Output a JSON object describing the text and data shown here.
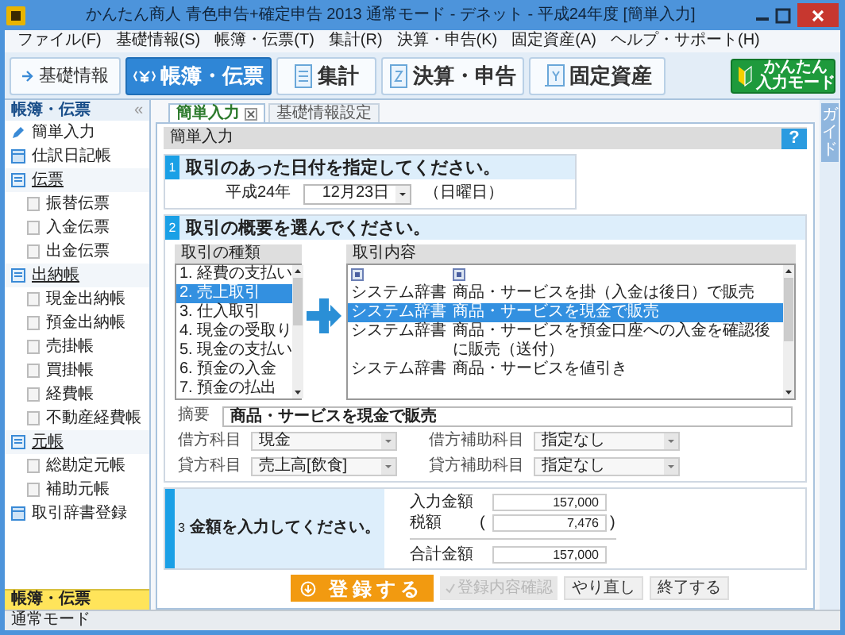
{
  "window": {
    "title": "かんたん商人 青色申告+確定申告 2013 通常モード - デネット - 平成24年度 [簡単入力]"
  },
  "menu": [
    "ファイル(F)",
    "基礎情報(S)",
    "帳簿・伝票(T)",
    "集計(R)",
    "決算・申告(K)",
    "固定資産(A)",
    "ヘルプ・サポート(H)"
  ],
  "toolbar": [
    {
      "label": "基礎情報",
      "kind": "arrow",
      "selected": false
    },
    {
      "label": "帳簿・伝票",
      "kind": "yen",
      "selected": true
    },
    {
      "label": "集計",
      "kind": "sheet",
      "selected": false
    },
    {
      "label": "決算・申告",
      "kind": "doc",
      "selected": false
    },
    {
      "label": "固定資産",
      "kind": "asset",
      "selected": false
    }
  ],
  "easy_mode_button": {
    "line1": "かんたん",
    "line2": "入力モード"
  },
  "sidebar": {
    "title": "帳簿・伝票",
    "collapse": "«",
    "items": [
      {
        "label": "簡単入力",
        "kind": "tool"
      },
      {
        "label": "仕訳日記帳",
        "kind": "book"
      },
      {
        "label": "伝票",
        "kind": "group",
        "children": [
          {
            "label": "振替伝票",
            "kind": "page"
          },
          {
            "label": "入金伝票",
            "kind": "page"
          },
          {
            "label": "出金伝票",
            "kind": "page"
          }
        ]
      },
      {
        "label": "出納帳",
        "kind": "group",
        "children": [
          {
            "label": "現金出納帳",
            "kind": "page"
          },
          {
            "label": "預金出納帳",
            "kind": "page"
          },
          {
            "label": "売掛帳",
            "kind": "page"
          },
          {
            "label": "買掛帳",
            "kind": "page"
          },
          {
            "label": "経費帳",
            "kind": "page"
          },
          {
            "label": "不動産経費帳",
            "kind": "page"
          }
        ]
      },
      {
        "label": "元帳",
        "kind": "group",
        "children": [
          {
            "label": "総勘定元帳",
            "kind": "page"
          },
          {
            "label": "補助元帳",
            "kind": "page"
          }
        ]
      },
      {
        "label": "取引辞書登録",
        "kind": "book"
      }
    ],
    "footer": "帳簿・伝票"
  },
  "tabs": [
    {
      "label": "簡単入力",
      "selected": true,
      "closable": true
    },
    {
      "label": "基礎情報設定",
      "selected": false,
      "closable": false
    }
  ],
  "panel": {
    "title": "簡単入力",
    "help": "?"
  },
  "guide_tab": "ガイド",
  "step1": {
    "number": "1",
    "title": "取引のあった日付を指定してください。",
    "era_year": "平成24年",
    "date": "12月23日",
    "weekday": "（日曜日）"
  },
  "step2": {
    "number": "2",
    "title": "取引の概要を選んでください。",
    "kinds_title": "取引の種類",
    "kinds": [
      {
        "label": "1. 経費の支払い",
        "selected": false
      },
      {
        "label": "2. 売上取引",
        "selected": true
      },
      {
        "label": "3. 仕入取引",
        "selected": false
      },
      {
        "label": "4. 現金の受取り",
        "selected": false
      },
      {
        "label": "5. 現金の支払い",
        "selected": false
      },
      {
        "label": "6. 預金の入金",
        "selected": false
      },
      {
        "label": "7. 預金の払出",
        "selected": false
      }
    ],
    "contents_title": "取引内容",
    "contents": [
      {
        "source": "システム辞書",
        "description": "商品・サービスを掛（入金は後日）で販売",
        "selected": false
      },
      {
        "source": "システム辞書",
        "description": "商品・サービスを現金で販売",
        "selected": true
      },
      {
        "source": "システム辞書",
        "description": "商品・サービスを預金口座への入金を確認後に販売（送付）",
        "selected": false
      },
      {
        "source": "システム辞書",
        "description": "商品・サービスを値引き",
        "selected": false
      }
    ],
    "summary_label": "摘要",
    "summary": "商品・サービスを現金で販売",
    "accounts": [
      {
        "label": "借方科目",
        "value": "現金",
        "sub_label": "借方補助科目",
        "sub_value": "指定なし"
      },
      {
        "label": "貸方科目",
        "value": "売上高[飲食]",
        "sub_label": "貸方補助科目",
        "sub_value": "指定なし"
      }
    ]
  },
  "step3": {
    "number": "3",
    "title": "金額を入力してください。",
    "input_label": "入力金額",
    "input_amount": "157,000",
    "tax_label": "税額",
    "tax_open": "(",
    "tax_amount": "7,476",
    "tax_close": ")",
    "total_label": "合計金額",
    "total_amount": "157,000"
  },
  "actions": [
    {
      "label": "登録する",
      "kind": "primary",
      "disabled": false
    },
    {
      "label": "登録内容確認",
      "kind": "check",
      "disabled": true
    },
    {
      "label": "やり直し",
      "kind": "plain",
      "disabled": false
    },
    {
      "label": "終了する",
      "kind": "plain",
      "disabled": false
    }
  ],
  "status_bar": "通常モード"
}
